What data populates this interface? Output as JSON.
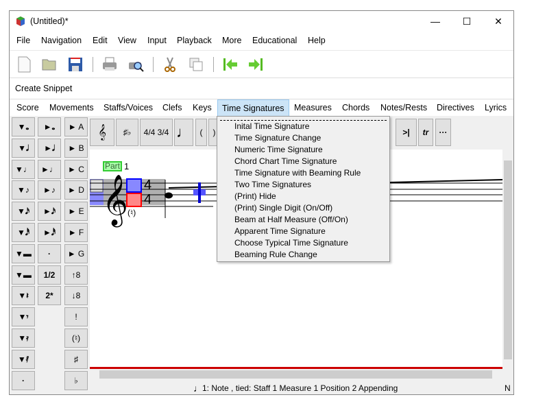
{
  "window": {
    "title": "(Untitled)*",
    "minimize": "—",
    "maximize": "☐",
    "close": "✕"
  },
  "menu": [
    "File",
    "Navigation",
    "Edit",
    "View",
    "Input",
    "Playback",
    "More",
    "Educational",
    "Help"
  ],
  "toolbar": [
    "new-icon",
    "open-icon",
    "save-icon",
    "print-icon",
    "print-preview-icon",
    "cut-icon",
    "copy-icon",
    "previous-movement-icon",
    "next-movement-icon"
  ],
  "snippet": {
    "label": "Create Snippet"
  },
  "tabs": [
    "Score",
    "Movements",
    "Staffs/Voices",
    "Clefs",
    "Keys",
    "Time Signatures",
    "Measures",
    "Chords",
    "Notes/Rests",
    "Directives",
    "Lyrics"
  ],
  "active_tab": "Time Signatures",
  "palette": {
    "col1": [
      "▼𝅝",
      "▼𝅗𝅥",
      "▼♩",
      "▼♪",
      "▼𝅘𝅥𝅯",
      "▼𝅘𝅥𝅰",
      "▼▬",
      "▼▬",
      "▼𝄽",
      "▼𝄾",
      "▼𝄿",
      "▼𝅀",
      "·"
    ],
    "col2": [
      "►𝅝",
      "►𝅗𝅥",
      "►♩",
      "►♪",
      "►𝅘𝅥𝅯",
      "►𝅘𝅥𝅰",
      "·",
      "1/2",
      "2*"
    ],
    "col3": [
      "► A",
      "► B",
      "► C",
      "► D",
      "► E",
      "► F",
      "► G",
      "↑8",
      "↓8",
      "!",
      "(♮)",
      "♯",
      "♭"
    ]
  },
  "score_toolbar": {
    "clef": "𝄞",
    "keys": "♯♭",
    "time": "4/4 3/4",
    "note": "♩",
    "open_paren": "(",
    "close_paren": ")",
    "end": ">|",
    "trill": "tr",
    "more": "···"
  },
  "score": {
    "part_label": "Part",
    "part_number": "1",
    "time_top": "4",
    "time_bottom": "4",
    "natural": "(♮)"
  },
  "dropdown": [
    "Inital Time Signature",
    "Time Signature Change",
    "Numeric Time Signature",
    "Chord Chart Time Signature",
    "Time Signature with Beaming Rule",
    "Two Time Signatures",
    "(Print) Hide",
    "(Print) Single Digit (On/Off)",
    "Beam at Half Measure (Off/On)",
    "Apparent Time Signature",
    "Choose Typical Time Signature",
    "Beaming Rule Change"
  ],
  "status": {
    "note_icon": "♩",
    "text": "1: Note , tied:  Staff 1 Measure 1 Position 2 Appending",
    "right": "N"
  }
}
